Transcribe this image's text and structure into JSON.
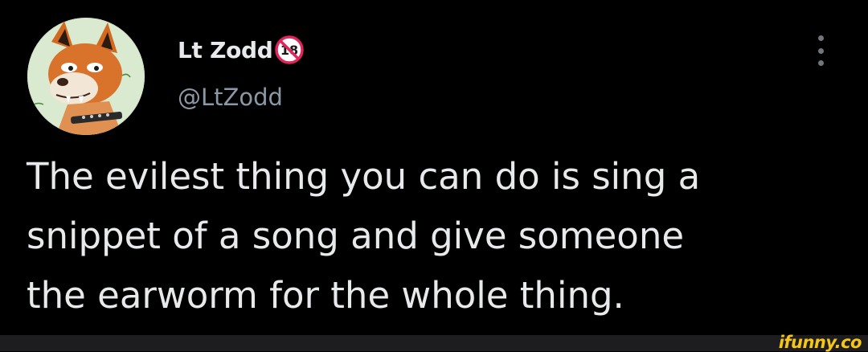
{
  "tweet": {
    "author": {
      "display_name": "Lt Zodd",
      "handle": "@LtZodd",
      "badge_icon": "no-under-18-icon",
      "avatar_icon": "fox-character-avatar"
    },
    "text_lines": [
      "The evilest thing you can do is sing a",
      "snippet of a song and give someone",
      "the earworm for the whole thing."
    ],
    "menu_icon": "more-vertical-icon"
  },
  "watermark": {
    "text": "ifunny.co",
    "color": "#f5c518"
  },
  "colors": {
    "background": "#000000",
    "primary_text": "#e7e9ea",
    "secondary_text": "#8b98a5",
    "badge_red": "#e0245e"
  }
}
